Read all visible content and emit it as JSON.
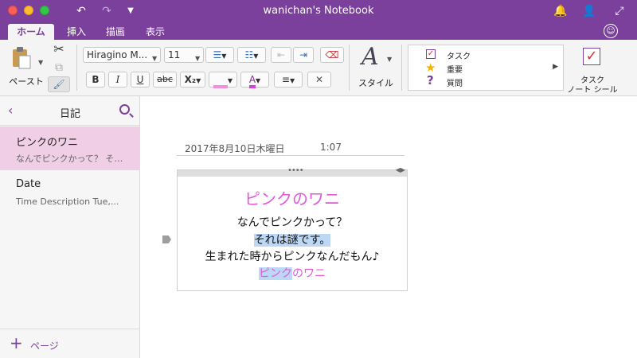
{
  "window": {
    "title": "wanichan's Notebook"
  },
  "ribbon_tabs": [
    {
      "label": "ホーム",
      "active": true
    },
    {
      "label": "挿入",
      "active": false
    },
    {
      "label": "描画",
      "active": false
    },
    {
      "label": "表示",
      "active": false
    }
  ],
  "ribbon": {
    "paste_label": "ペースト",
    "font_name": "Hiragino M...",
    "font_size": "11",
    "bold": "B",
    "italic": "I",
    "underline": "U",
    "strike": "abc",
    "subscript": "X₂",
    "styles_label": "スタイル",
    "tags": [
      "タスク",
      "重要",
      "質問"
    ],
    "task_label_1": "タスク",
    "task_label_2": "ノート シール"
  },
  "sidebar": {
    "title": "日記",
    "pages": [
      {
        "title": "ピンクのワニ",
        "preview": "なんでピンクかって？ そ…"
      },
      {
        "title": "Date",
        "preview": "Time Description Tue,..."
      }
    ],
    "add_page": "ページ"
  },
  "note": {
    "date": "2017年8月10日木曜日",
    "time": "1:07",
    "heading": "ピンクのワニ",
    "lines": [
      "なんでピンクかって？",
      "それは謎です。",
      "生まれた時からピンクなんだもん♪"
    ],
    "last_line_highlight": "ピンク",
    "last_line_rest": "のワニ"
  },
  "colors": {
    "accent": "#7b3f9c",
    "heading_pink": "#e059d9",
    "selection": "#bcd8f5",
    "selected_page": "#f0cfe6"
  }
}
